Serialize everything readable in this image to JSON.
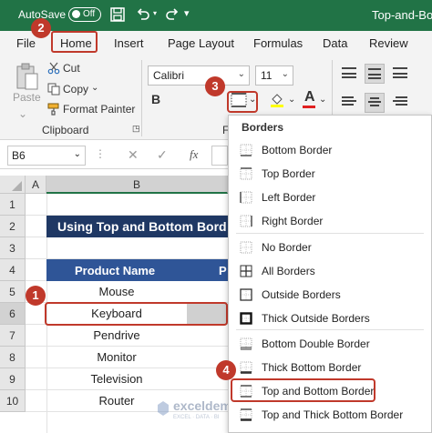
{
  "titlebar": {
    "autosave_label": "AutoSave",
    "toggle_state": "Off",
    "doc_title": "Top-and-Bott"
  },
  "menu": {
    "items": [
      "File",
      "Home",
      "Insert",
      "Page Layout",
      "Formulas",
      "Data",
      "Review"
    ]
  },
  "ribbon": {
    "paste_label": "Paste",
    "cut_label": "Cut",
    "copy_label": "Copy",
    "format_painter_label": "Format Painter",
    "clipboard_group": "Clipboard",
    "font_name": "Calibri",
    "font_size": "11",
    "font_group_letter": "F"
  },
  "formula": {
    "name_box": "B6",
    "fx": "fx"
  },
  "grid": {
    "columns": [
      "A",
      "B"
    ],
    "rows": [
      "1",
      "2",
      "3",
      "4",
      "5",
      "6",
      "7",
      "8",
      "9",
      "10"
    ],
    "title_text": "Using Top and Bottom Bord",
    "header_text": "Product Name",
    "header_partial": "P",
    "products": [
      "Mouse",
      "Keyboard",
      "Pendrive",
      "Monitor",
      "Television",
      "Router"
    ]
  },
  "borders_menu": {
    "title": "Borders",
    "items": [
      "Bottom Border",
      "Top Border",
      "Left Border",
      "Right Border",
      "No Border",
      "All Borders",
      "Outside Borders",
      "Thick Outside Borders",
      "Bottom Double Border",
      "Thick Bottom Border",
      "Top and Bottom Border",
      "Top and Thick Bottom Border"
    ]
  },
  "badges": [
    "1",
    "2",
    "3",
    "4"
  ],
  "watermark": {
    "name": "exceldemy",
    "tagline": "EXCEL · DATA · BI"
  },
  "colors": {
    "excel_green": "#217346",
    "header_blue": "#1f3864",
    "badge_red": "#c0392b"
  }
}
